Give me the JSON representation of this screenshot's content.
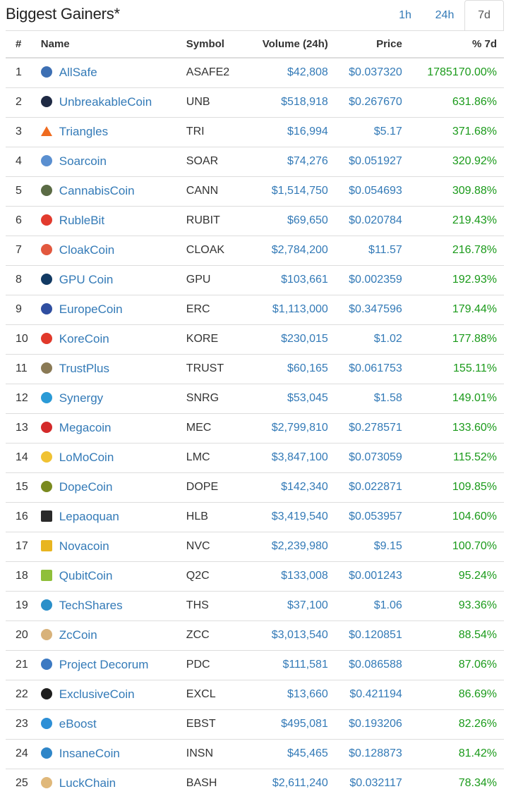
{
  "header": {
    "title": "Biggest Gainers*",
    "tabs": [
      {
        "label": "1h",
        "active": false
      },
      {
        "label": "24h",
        "active": false
      },
      {
        "label": "7d",
        "active": true
      }
    ]
  },
  "table": {
    "columns": {
      "rank": "#",
      "name": "Name",
      "symbol": "Symbol",
      "volume": "Volume (24h)",
      "price": "Price",
      "change": "% 7d"
    },
    "rows": [
      {
        "rank": "1",
        "name": "AllSafe",
        "symbol": "ASAFE2",
        "volume": "$42,808",
        "price": "$0.037320",
        "change": "1785170.00%",
        "icon": "allsafe-icon",
        "color": "#3d6fb3"
      },
      {
        "rank": "2",
        "name": "UnbreakableCoin",
        "symbol": "UNB",
        "volume": "$518,918",
        "price": "$0.267670",
        "change": "631.86%",
        "icon": "unbreakablecoin-icon",
        "color": "#1f2a44"
      },
      {
        "rank": "3",
        "name": "Triangles",
        "symbol": "TRI",
        "volume": "$16,994",
        "price": "$5.17",
        "change": "371.68%",
        "icon": "triangles-icon",
        "color": "#ef6b1f"
      },
      {
        "rank": "4",
        "name": "Soarcoin",
        "symbol": "SOAR",
        "volume": "$74,276",
        "price": "$0.051927",
        "change": "320.92%",
        "icon": "soarcoin-icon",
        "color": "#5a8fd0"
      },
      {
        "rank": "5",
        "name": "CannabisCoin",
        "symbol": "CANN",
        "volume": "$1,514,750",
        "price": "$0.054693",
        "change": "309.88%",
        "icon": "cannabiscoin-icon",
        "color": "#5b6b45"
      },
      {
        "rank": "6",
        "name": "RubleBit",
        "symbol": "RUBIT",
        "volume": "$69,650",
        "price": "$0.020784",
        "change": "219.43%",
        "icon": "rublebit-icon",
        "color": "#e23b2e"
      },
      {
        "rank": "7",
        "name": "CloakCoin",
        "symbol": "CLOAK",
        "volume": "$2,784,200",
        "price": "$11.57",
        "change": "216.78%",
        "icon": "cloakcoin-icon",
        "color": "#e2583e"
      },
      {
        "rank": "8",
        "name": "GPU Coin",
        "symbol": "GPU",
        "volume": "$103,661",
        "price": "$0.002359",
        "change": "192.93%",
        "icon": "gpucoin-icon",
        "color": "#123a63"
      },
      {
        "rank": "9",
        "name": "EuropeCoin",
        "symbol": "ERC",
        "volume": "$1,113,000",
        "price": "$0.347596",
        "change": "179.44%",
        "icon": "europecoin-icon",
        "color": "#2f4ea0"
      },
      {
        "rank": "10",
        "name": "KoreCoin",
        "symbol": "KORE",
        "volume": "$230,015",
        "price": "$1.02",
        "change": "177.88%",
        "icon": "korecoin-icon",
        "color": "#e1392b"
      },
      {
        "rank": "11",
        "name": "TrustPlus",
        "symbol": "TRUST",
        "volume": "$60,165",
        "price": "$0.061753",
        "change": "155.11%",
        "icon": "trustplus-icon",
        "color": "#8a7a55"
      },
      {
        "rank": "12",
        "name": "Synergy",
        "symbol": "SNRG",
        "volume": "$53,045",
        "price": "$1.58",
        "change": "149.01%",
        "icon": "synergy-icon",
        "color": "#2a9ad6"
      },
      {
        "rank": "13",
        "name": "Megacoin",
        "symbol": "MEC",
        "volume": "$2,799,810",
        "price": "$0.278571",
        "change": "133.60%",
        "icon": "megacoin-icon",
        "color": "#d42a2a"
      },
      {
        "rank": "14",
        "name": "LoMoCoin",
        "symbol": "LMC",
        "volume": "$3,847,100",
        "price": "$0.073059",
        "change": "115.52%",
        "icon": "lomocoin-icon",
        "color": "#f0c233"
      },
      {
        "rank": "15",
        "name": "DopeCoin",
        "symbol": "DOPE",
        "volume": "$142,340",
        "price": "$0.022871",
        "change": "109.85%",
        "icon": "dopecoin-icon",
        "color": "#7a8a1f"
      },
      {
        "rank": "16",
        "name": "Lepaoquan",
        "symbol": "HLB",
        "volume": "$3,419,540",
        "price": "$0.053957",
        "change": "104.60%",
        "icon": "lepaoquan-icon",
        "color": "#2a2a2a"
      },
      {
        "rank": "17",
        "name": "Novacoin",
        "symbol": "NVC",
        "volume": "$2,239,980",
        "price": "$9.15",
        "change": "100.70%",
        "icon": "novacoin-icon",
        "color": "#e8b520"
      },
      {
        "rank": "18",
        "name": "QubitCoin",
        "symbol": "Q2C",
        "volume": "$133,008",
        "price": "$0.001243",
        "change": "95.24%",
        "icon": "qubitcoin-icon",
        "color": "#8fbf3a"
      },
      {
        "rank": "19",
        "name": "TechShares",
        "symbol": "THS",
        "volume": "$37,100",
        "price": "$1.06",
        "change": "93.36%",
        "icon": "techshares-icon",
        "color": "#2a8fc9"
      },
      {
        "rank": "20",
        "name": "ZcCoin",
        "symbol": "ZCC",
        "volume": "$3,013,540",
        "price": "$0.120851",
        "change": "88.54%",
        "icon": "zccoin-icon",
        "color": "#d8b27a"
      },
      {
        "rank": "21",
        "name": "Project Decorum",
        "symbol": "PDC",
        "volume": "$111,581",
        "price": "$0.086588",
        "change": "87.06%",
        "icon": "projectdecorum-icon",
        "color": "#3c79c2"
      },
      {
        "rank": "22",
        "name": "ExclusiveCoin",
        "symbol": "EXCL",
        "volume": "$13,660",
        "price": "$0.421194",
        "change": "86.69%",
        "icon": "exclusivecoin-icon",
        "color": "#1e1e1e"
      },
      {
        "rank": "23",
        "name": "eBoost",
        "symbol": "EBST",
        "volume": "$495,081",
        "price": "$0.193206",
        "change": "82.26%",
        "icon": "eboost-icon",
        "color": "#2d8fd6"
      },
      {
        "rank": "24",
        "name": "InsaneCoin",
        "symbol": "INSN",
        "volume": "$45,465",
        "price": "$0.128873",
        "change": "81.42%",
        "icon": "insanecoin-icon",
        "color": "#2f86c8"
      },
      {
        "rank": "25",
        "name": "LuckChain",
        "symbol": "BASH",
        "volume": "$2,611,240",
        "price": "$0.032117",
        "change": "78.34%",
        "icon": "luckchain-icon",
        "color": "#e0b87a"
      }
    ]
  }
}
